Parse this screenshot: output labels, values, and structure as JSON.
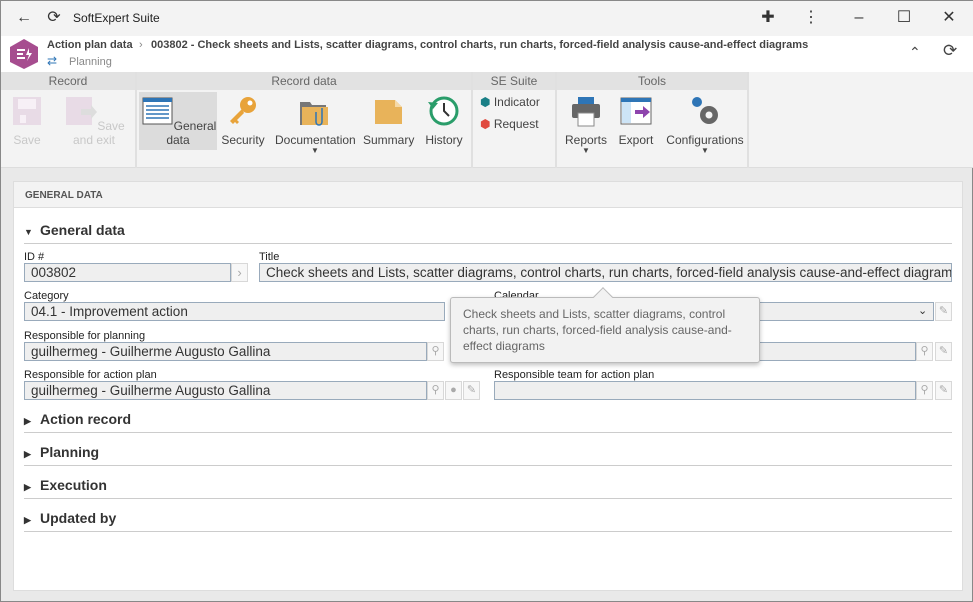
{
  "window": {
    "title": "SoftExpert Suite"
  },
  "header": {
    "breadcrumb_root": "Action plan data",
    "breadcrumb_sep": "›",
    "record": "003802 - Check sheets and Lists, scatter diagrams, control charts, run charts, forced-field analysis cause-and-effect diagrams",
    "subtitle": "Planning"
  },
  "ribbon": {
    "groups": {
      "record": "Record",
      "record_data": "Record data",
      "se_suite": "SE Suite",
      "tools": "Tools"
    },
    "save": "Save",
    "save_exit": "Save and exit",
    "general_data": "General data",
    "security": "Security",
    "documentation": "Documentation",
    "summary": "Summary",
    "history": "History",
    "indicator": "Indicator",
    "request": "Request",
    "reports": "Reports",
    "export": "Export",
    "configurations": "Configurations"
  },
  "panel": {
    "title": "GENERAL DATA"
  },
  "sections": {
    "general": "General data",
    "action_record": "Action record",
    "planning": "Planning",
    "execution": "Execution",
    "updated_by": "Updated by"
  },
  "fields": {
    "id_label": "ID #",
    "id_value": "003802",
    "title_label": "Title",
    "title_value": "Check sheets and Lists, scatter diagrams, control charts, run charts, forced-field analysis cause-and-effect diagrams",
    "category_label": "Category",
    "category_value": "04.1 - Improvement action",
    "calendar_label": "Calendar",
    "calendar_value": "",
    "resp_planning_label": "Responsible for planning",
    "resp_planning_value": "guilhermeg - Guilherme Augusto Gallina",
    "resp_action_label": "Responsible for action plan",
    "resp_action_value": "guilhermeg - Guilherme Augusto Gallina",
    "resp_team_label": "Responsible team for action plan",
    "resp_team_value": ""
  },
  "tooltip": "Check sheets and Lists, scatter diagrams, control charts, run charts, forced-field analysis cause-and-effect diagrams",
  "colors": {
    "logo": "#a64d8f",
    "accent_blue": "#2e75b6",
    "key": "#e8a33a",
    "history": "#2a9d6a"
  }
}
